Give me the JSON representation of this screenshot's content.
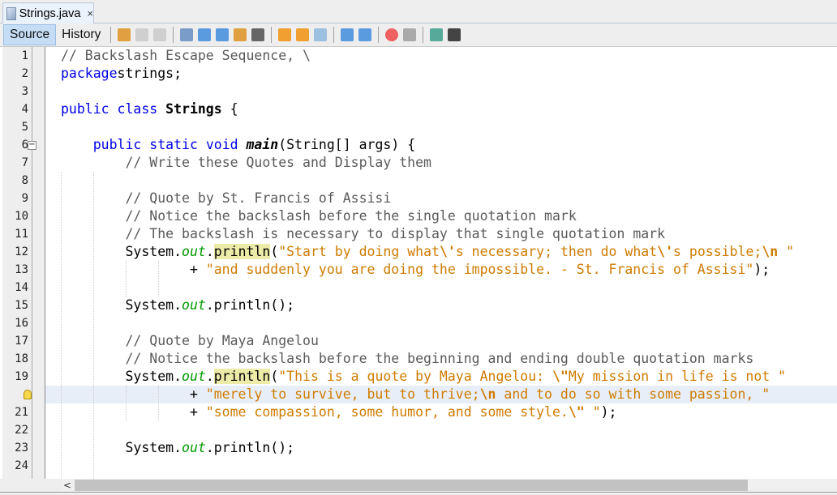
{
  "tab": {
    "title": "Strings.java",
    "close": "×"
  },
  "toolbar": {
    "source": "Source",
    "history": "History",
    "icons": [
      "last-edit-icon",
      "back-icon",
      "forward-icon",
      "find-icon",
      "find-previous-icon",
      "find-next-icon",
      "toggle-highlight-icon",
      "rectangular-selection-icon",
      "previous-bookmark-icon",
      "next-bookmark-icon",
      "toggle-bookmark-icon",
      "shift-left-icon",
      "shift-right-icon",
      "start-macro-icon",
      "stop-macro-icon",
      "comment-icon",
      "uncomment-icon"
    ]
  },
  "colors": {
    "keyword": "#0000e6",
    "string": "#ce7b00",
    "comment": "#5a5a5a",
    "field": "#009900",
    "current_line": "#e8eef8",
    "mark": "#eceba8"
  },
  "editor": {
    "current_line": 20,
    "lines": [
      {
        "n": "1",
        "t": [
          [
            "cm",
            "// Backslash Escape Sequence, \\"
          ]
        ]
      },
      {
        "n": "2",
        "t": [
          [
            "kw",
            "package"
          ],
          [
            "",
            "strings;"
          ]
        ]
      },
      {
        "n": "3",
        "t": []
      },
      {
        "n": "4",
        "t": [
          [
            "kw",
            "public class "
          ],
          [
            "b",
            "Strings"
          ],
          [
            "",
            " {"
          ]
        ]
      },
      {
        "n": "5",
        "t": []
      },
      {
        "n": "6",
        "t": [
          [
            "",
            "    "
          ],
          [
            "kw",
            "public static void "
          ],
          [
            "bi",
            "main"
          ],
          [
            "",
            "(String[] args) {"
          ]
        ]
      },
      {
        "n": "7",
        "t": [
          [
            "",
            "        "
          ],
          [
            "cm",
            "// Write these Quotes and Display them"
          ]
        ]
      },
      {
        "n": "8",
        "t": []
      },
      {
        "n": "9",
        "t": [
          [
            "",
            "        "
          ],
          [
            "cm",
            "// Quote by St. Francis of Assisi"
          ]
        ]
      },
      {
        "n": "10",
        "t": [
          [
            "",
            "        "
          ],
          [
            "cm",
            "// Notice the backslash before the single quotation mark"
          ]
        ]
      },
      {
        "n": "11",
        "t": [
          [
            "",
            "        "
          ],
          [
            "cm",
            "// The backslash is necessary to display that single quotation mark"
          ]
        ]
      },
      {
        "n": "12",
        "t": [
          [
            "",
            "        System."
          ],
          [
            "fld",
            "out"
          ],
          [
            "",
            "."
          ],
          [
            "mk",
            "println"
          ],
          [
            "",
            "("
          ],
          [
            "st",
            "\"Start by doing what"
          ],
          [
            "esc",
            "\\'"
          ],
          [
            "st",
            "s necessary; then do what"
          ],
          [
            "esc",
            "\\'"
          ],
          [
            "st",
            "s possible;"
          ],
          [
            "esc",
            "\\n"
          ],
          [
            "st",
            " \""
          ]
        ]
      },
      {
        "n": "13",
        "t": [
          [
            "",
            "                + "
          ],
          [
            "st",
            "\"and suddenly you are doing the impossible. - St. Francis of Assisi\""
          ],
          [
            "",
            ");"
          ]
        ]
      },
      {
        "n": "14",
        "t": []
      },
      {
        "n": "15",
        "t": [
          [
            "",
            "        System."
          ],
          [
            "fld",
            "out"
          ],
          [
            "",
            ".println();"
          ]
        ]
      },
      {
        "n": "16",
        "t": []
      },
      {
        "n": "17",
        "t": [
          [
            "",
            "        "
          ],
          [
            "cm",
            "// Quote by Maya Angelou"
          ]
        ]
      },
      {
        "n": "18",
        "t": [
          [
            "",
            "        "
          ],
          [
            "cm",
            "// Notice the backslash before the beginning and ending double quotation marks"
          ]
        ]
      },
      {
        "n": "19",
        "t": [
          [
            "",
            "        System."
          ],
          [
            "fld",
            "out"
          ],
          [
            "",
            "."
          ],
          [
            "mk",
            "println"
          ],
          [
            "",
            "("
          ],
          [
            "st",
            "\"This is a quote by Maya Angelou: "
          ],
          [
            "esc",
            "\\\""
          ],
          [
            "st",
            "My mission in life is not \""
          ]
        ]
      },
      {
        "n": "",
        "t": [
          [
            "",
            "                + "
          ],
          [
            "st",
            "\"merely to survive, but to thrive;"
          ],
          [
            "esc",
            "\\n"
          ],
          [
            "st",
            " and to do so with some passion, \""
          ]
        ]
      },
      {
        "n": "21",
        "t": [
          [
            "",
            "                + "
          ],
          [
            "st",
            "\"some compassion, some humor, and some style."
          ],
          [
            "esc",
            "\\\""
          ],
          [
            "st",
            " \""
          ],
          [
            "",
            ");"
          ]
        ]
      },
      {
        "n": "22",
        "t": []
      },
      {
        "n": "23",
        "t": [
          [
            "",
            "        System."
          ],
          [
            "fld",
            "out"
          ],
          [
            "",
            ".println();"
          ]
        ]
      },
      {
        "n": "24",
        "t": []
      }
    ]
  },
  "scrollbar": {
    "left_arrow": "<"
  }
}
